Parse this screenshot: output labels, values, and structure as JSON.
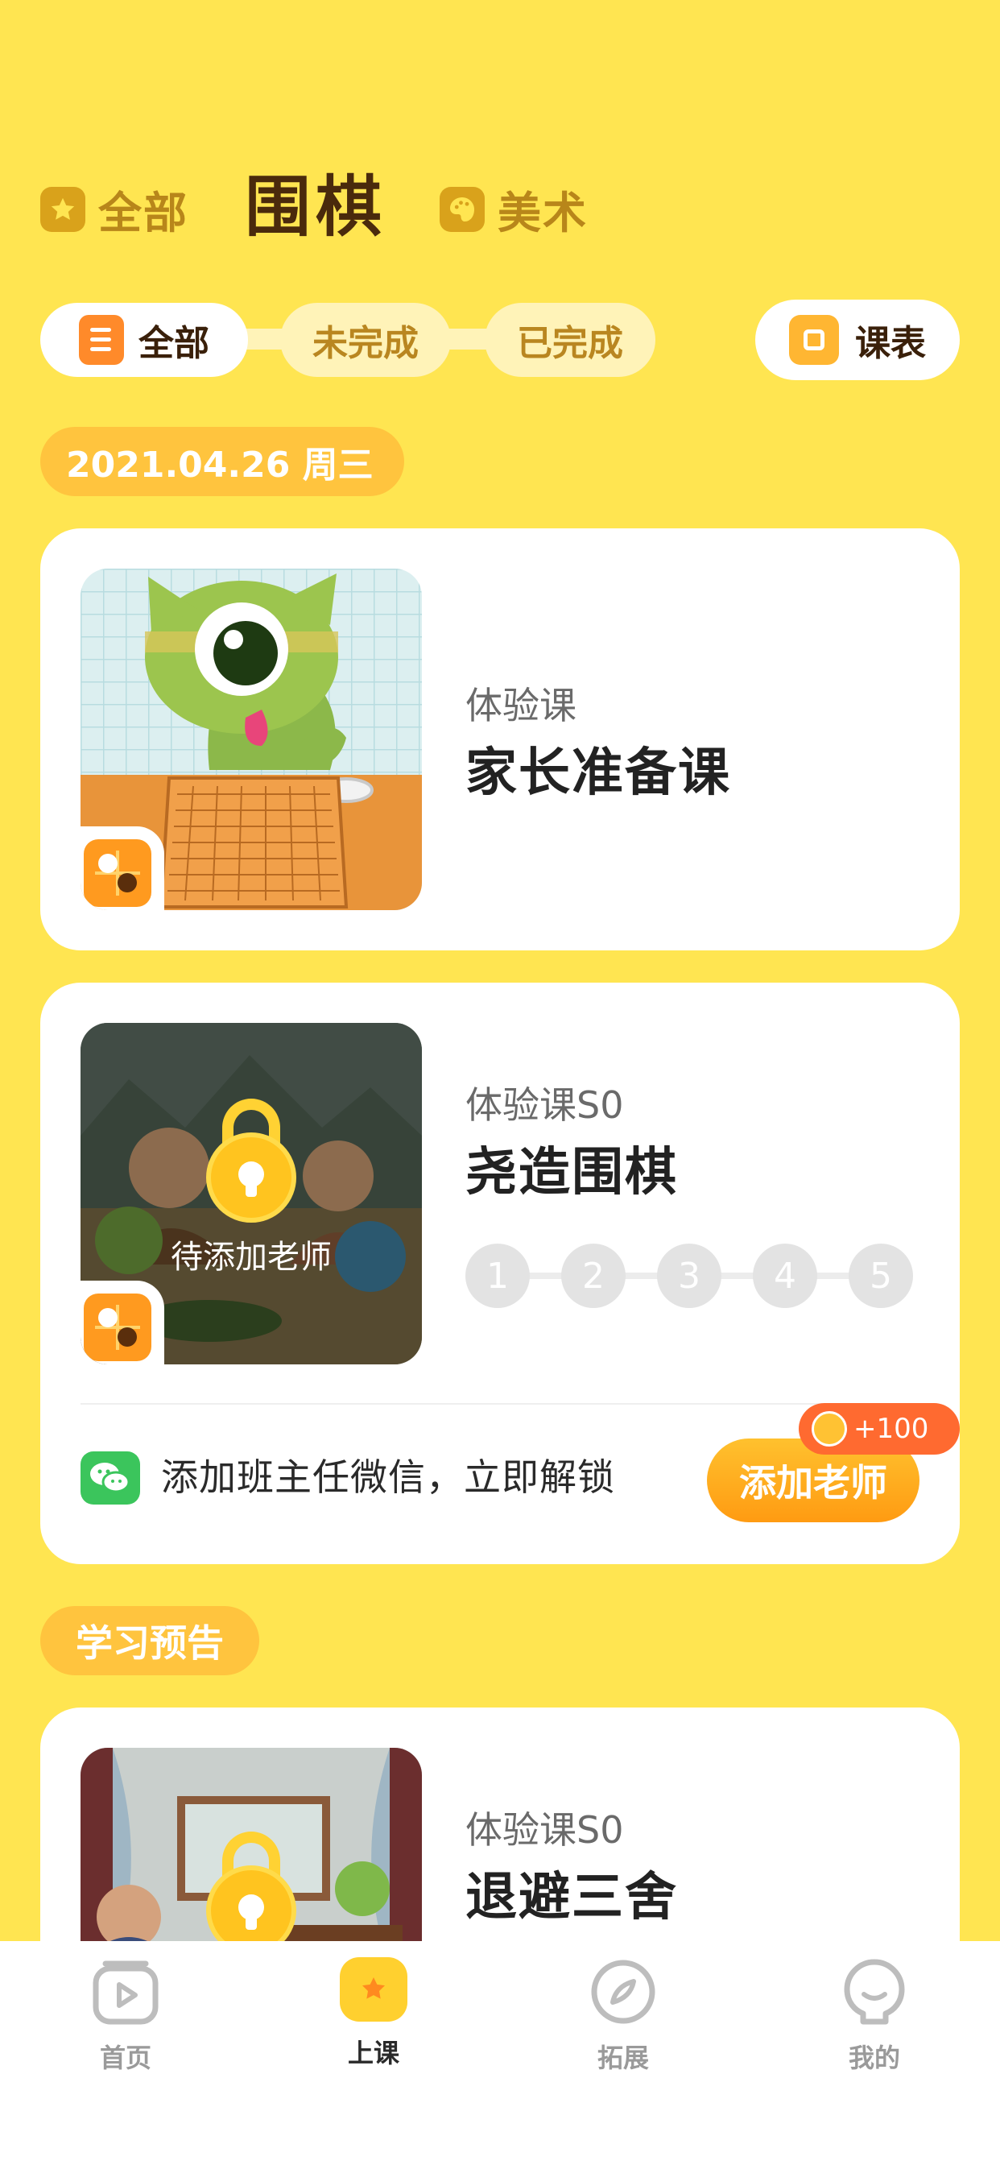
{
  "subjects": [
    {
      "label": "全部",
      "icon": "star-icon"
    },
    {
      "label": "围棋",
      "active": true
    },
    {
      "label": "美术",
      "icon": "palette-icon"
    }
  ],
  "filters": {
    "all": "全部",
    "incomplete": "未完成",
    "complete": "已完成",
    "schedule": "课表"
  },
  "date_tag": "2021.04.26  周三",
  "cards": [
    {
      "sub": "体验课",
      "title": "家长准备课"
    },
    {
      "sub": "体验课S0",
      "title": "尧造围棋",
      "lock_label": "待添加老师",
      "steps": [
        "1",
        "2",
        "3",
        "4",
        "5"
      ],
      "unlock_text": "添加班主任微信，立即解锁",
      "add_button": "添加老师",
      "reward": "+100"
    }
  ],
  "section_tag": "学习预告",
  "preview": {
    "sub": "体验课S0",
    "title": "退避三舍"
  },
  "tabbar": [
    {
      "label": "首页",
      "icon": "play-icon"
    },
    {
      "label": "上课",
      "icon": "flower-icon",
      "active": true
    },
    {
      "label": "拓展",
      "icon": "compass-icon"
    },
    {
      "label": "我的",
      "icon": "face-icon"
    }
  ],
  "colors": {
    "background": "#FFE551",
    "accent": "#FFC43E",
    "button": "#FF9B12",
    "reward": "#FF6A30"
  }
}
